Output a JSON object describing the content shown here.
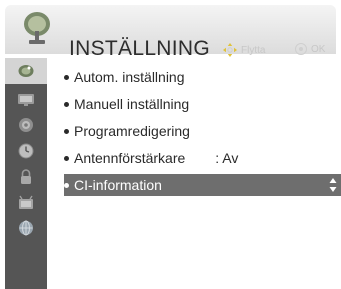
{
  "header": {
    "title": "INSTÄLLNING",
    "hint_move_label": "Flytta",
    "hint_ok_label": "OK",
    "logo_icon": "settings-satellite-dish-icon"
  },
  "sidebar": {
    "items": [
      {
        "icon": "antenna-dish-icon",
        "active": true
      },
      {
        "icon": "picture-icon",
        "active": false
      },
      {
        "icon": "audio-icon",
        "active": false
      },
      {
        "icon": "clock-icon",
        "active": false
      },
      {
        "icon": "lock-icon",
        "active": false
      },
      {
        "icon": "options-icon",
        "active": false
      },
      {
        "icon": "network-icon",
        "active": false
      }
    ]
  },
  "menu": {
    "items": [
      {
        "label": "Autom. inställning",
        "value": ""
      },
      {
        "label": "Manuell inställning",
        "value": ""
      },
      {
        "label": "Programredigering",
        "value": ""
      },
      {
        "label": "Antennförstärkare",
        "value": ": Av"
      },
      {
        "label": "CI-information",
        "value": "",
        "selected": true
      }
    ]
  },
  "colors": {
    "sidebar_bg": "#555555",
    "selected_row": "#6e6e6e",
    "active_tab": "#d4d4d4"
  }
}
